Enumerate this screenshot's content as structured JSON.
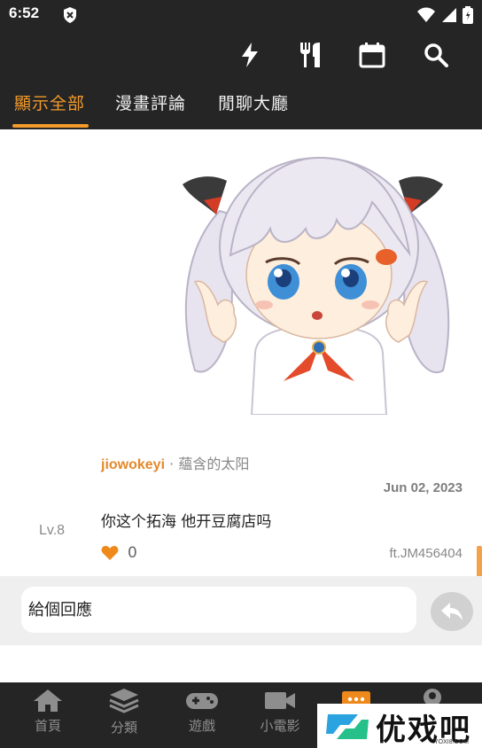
{
  "status_bar": {
    "time": "6:52"
  },
  "tabs": [
    {
      "label": "顯示全部",
      "active": true
    },
    {
      "label": "漫畫評論",
      "active": false
    },
    {
      "label": "閒聊大廳",
      "active": false
    }
  ],
  "toolbar_icons": [
    "flash-icon",
    "restaurant-icon",
    "calendar-icon",
    "search-icon"
  ],
  "post": {
    "author": "jiowokeyi",
    "separator": "·",
    "nickname": "蘊含的太阳",
    "date": "Jun 02, 2023",
    "body": "你这个拓海 他开豆腐店吗",
    "level": "Lv.8",
    "likes": "0",
    "code": "ft.JM456404"
  },
  "reply": {
    "placeholder": "給個回應"
  },
  "bottom_nav": [
    {
      "label": "首頁",
      "icon": "home-icon"
    },
    {
      "label": "分類",
      "icon": "layers-icon"
    },
    {
      "label": "遊戲",
      "icon": "gamepad-icon"
    },
    {
      "label": "小電影",
      "icon": "video-icon"
    },
    {
      "label": "",
      "icon": "chat-icon"
    },
    {
      "label": "",
      "icon": "profile-icon"
    }
  ],
  "watermark": {
    "text": "优戏吧",
    "sub": "YOXI8.COM"
  },
  "colors": {
    "accent": "#f39a2b",
    "dark_bg": "#252525",
    "username": "#e3892c",
    "reply_bg": "#efefef"
  }
}
